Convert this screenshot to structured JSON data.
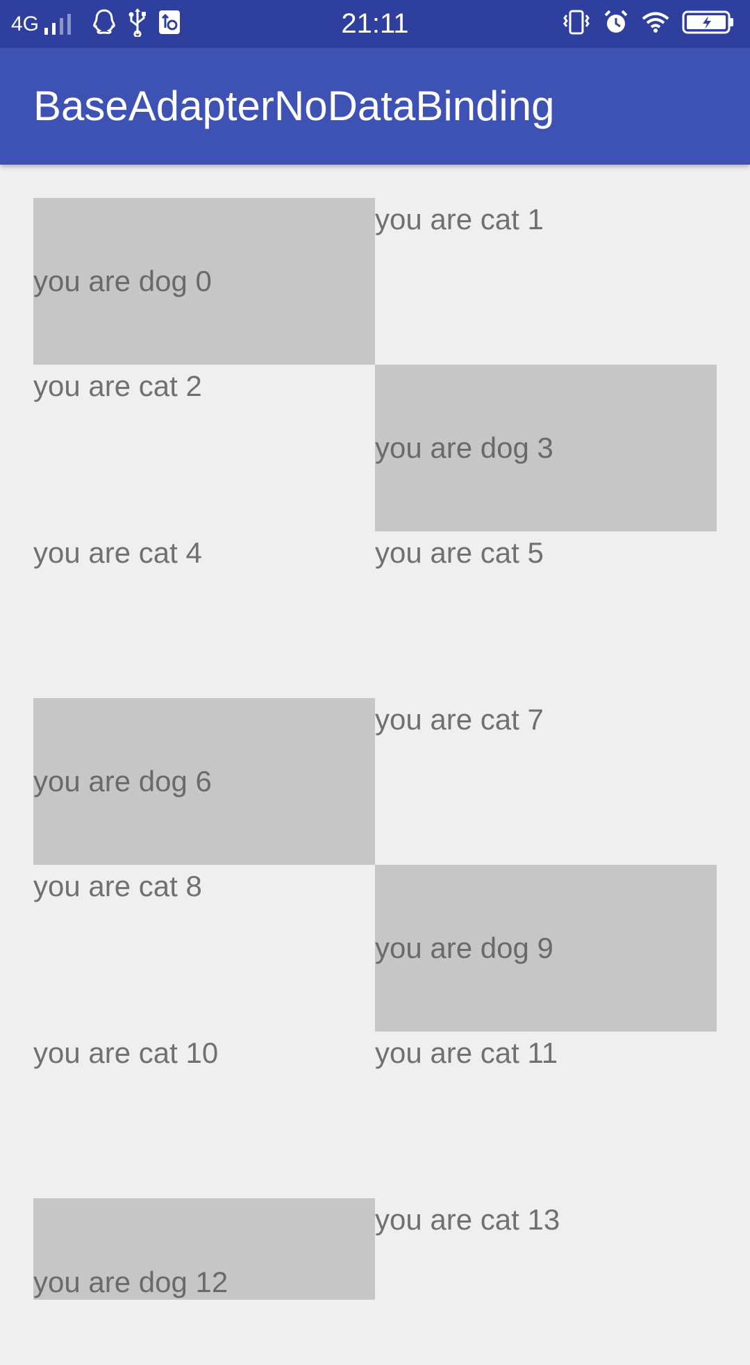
{
  "status_bar": {
    "network": "4G",
    "time": "21:11"
  },
  "app_bar": {
    "title": "BaseAdapterNoDataBinding"
  },
  "colors": {
    "status_bar": "#2f3f9e",
    "app_bar": "#3e52b4",
    "background": "#efefef",
    "dog_cell": "#c6c6c6",
    "text": "#707070"
  },
  "items": [
    {
      "type": "dog",
      "label": "you are dog 0"
    },
    {
      "type": "cat",
      "label": "you are cat 1"
    },
    {
      "type": "cat",
      "label": "you are cat 2"
    },
    {
      "type": "dog",
      "label": "you are dog 3"
    },
    {
      "type": "cat",
      "label": "you are cat 4"
    },
    {
      "type": "cat",
      "label": "you are cat 5"
    },
    {
      "type": "dog",
      "label": "you are dog 6"
    },
    {
      "type": "cat",
      "label": "you are cat 7"
    },
    {
      "type": "cat",
      "label": "you are cat 8"
    },
    {
      "type": "dog",
      "label": "you are dog 9"
    },
    {
      "type": "cat",
      "label": "you are cat 10"
    },
    {
      "type": "cat",
      "label": "you are cat 11"
    },
    {
      "type": "dog",
      "label": "you are dog 12"
    },
    {
      "type": "cat",
      "label": "you are cat 13"
    }
  ]
}
